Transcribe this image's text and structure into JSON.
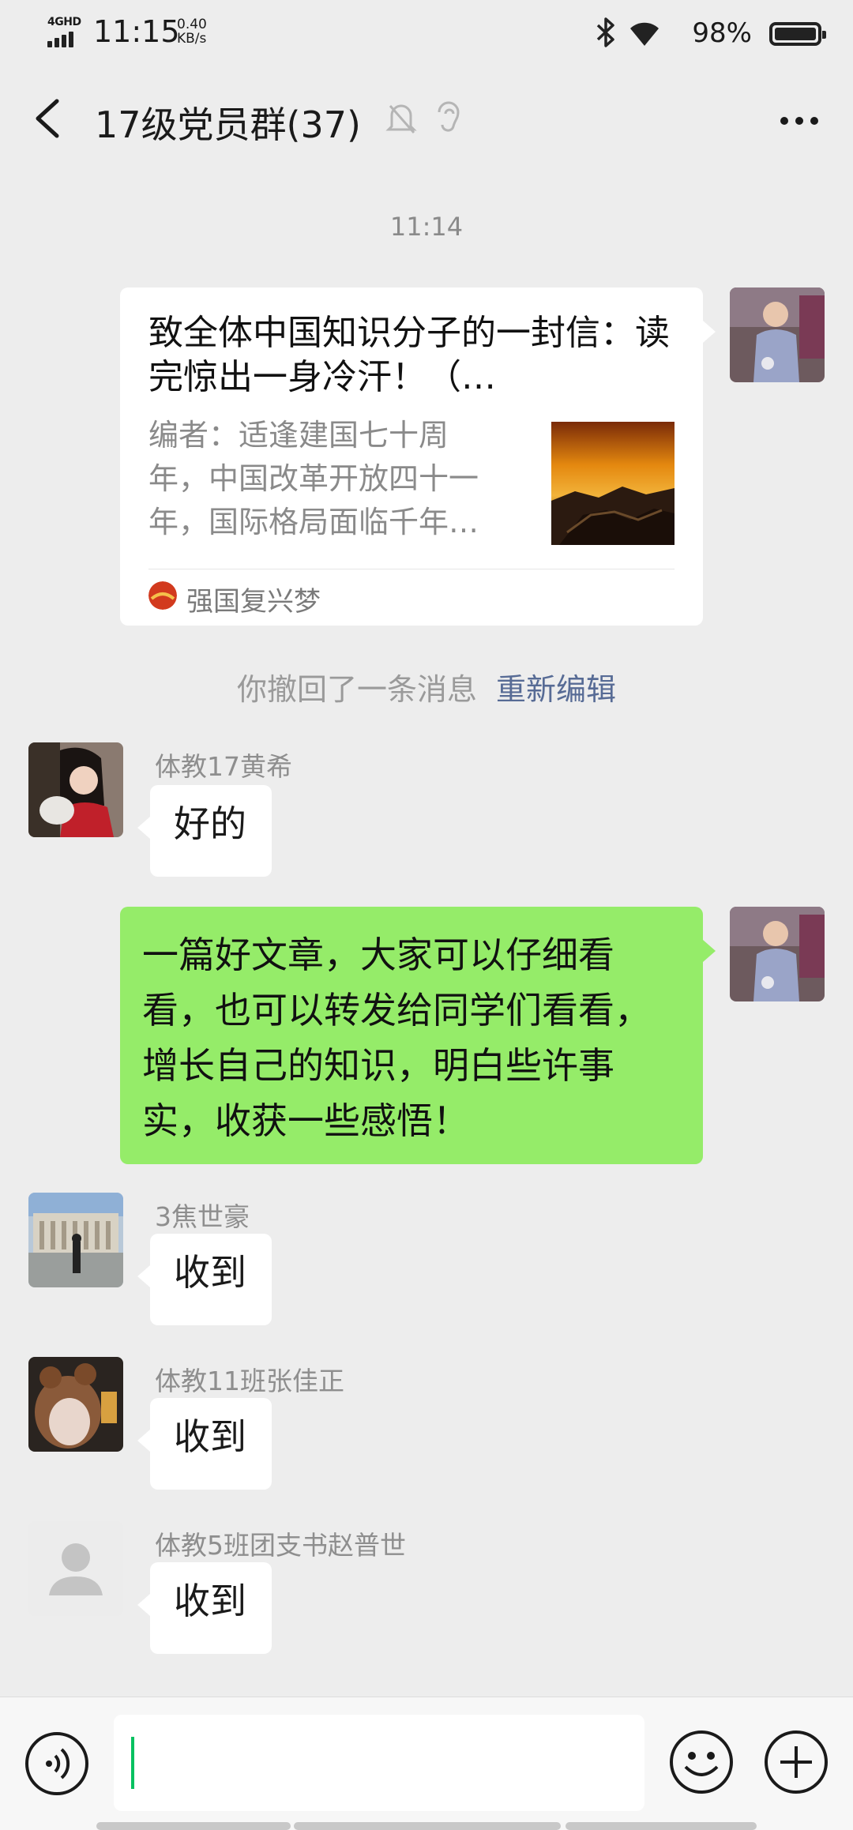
{
  "status_bar": {
    "network": "4GHD",
    "time": "11:15",
    "speed_value": "0.40",
    "speed_unit": "KB/s",
    "battery": "98%"
  },
  "nav": {
    "title": "17级党员群(37)"
  },
  "chat": {
    "timestamp": "11:14",
    "article_card": {
      "title": "致全体中国知识分子的一封信：读完惊出一身冷汗！（…",
      "description": "编者：适逢建国七十周年，中国改革开放四十一年，国际格局面临千年…",
      "source": "强国复兴梦"
    },
    "recall_notice": {
      "text": "你撤回了一条消息",
      "action": "重新编辑"
    },
    "messages": [
      {
        "sender": "体教17黄希",
        "text": "好的"
      },
      {
        "sender": "",
        "text": "一篇好文章，大家可以仔细看看，也可以转发给同学们看看，增长自己的知识，明白些许事实，收获一些感悟！"
      },
      {
        "sender": "3焦世豪",
        "text": "收到"
      },
      {
        "sender": "体教11班张佳正",
        "text": "收到"
      },
      {
        "sender": "体教5班团支书赵普世",
        "text": "收到"
      }
    ]
  },
  "input_bar": {
    "text": ""
  },
  "colors": {
    "background": "#ededed",
    "self_bubble": "#95ec69",
    "link": "#576b95",
    "caret": "#07c160"
  },
  "icons": [
    "bluetooth-icon",
    "wifi-icon",
    "battery-icon",
    "back-icon",
    "mute-bell-icon",
    "earpiece-icon",
    "more-icon",
    "voice-icon",
    "emoji-icon",
    "plus-icon"
  ]
}
